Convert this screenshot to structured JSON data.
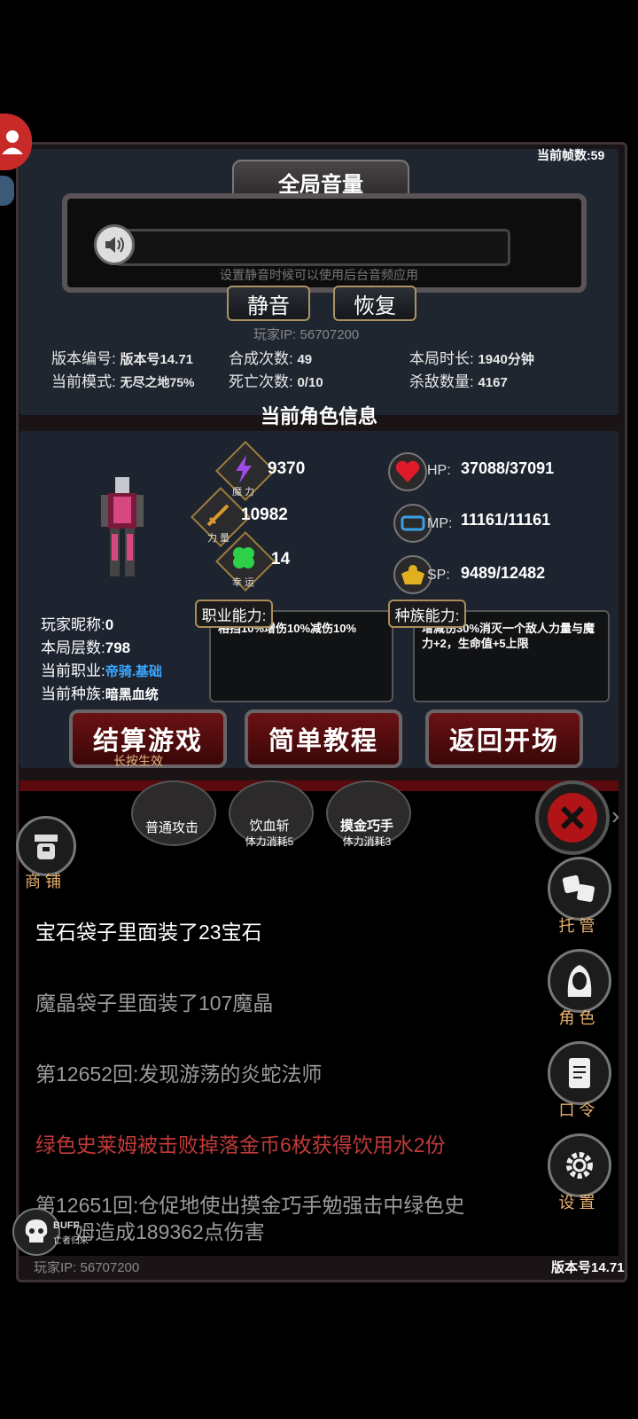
{
  "header": {
    "frame_counter": "当前帧数:59"
  },
  "volume": {
    "title": "全局音量",
    "hint": "设置静音时候可以使用后台音频应用",
    "mute_label": "静音",
    "restore_label": "恢复"
  },
  "player_ip_top": "玩家IP:  56707200",
  "stats": {
    "version_label": "版本编号:",
    "version_value": "版本号14.71",
    "mode_label": "当前模式:",
    "mode_value": "无尽之地75%",
    "craft_label": "合成次数:",
    "craft_value": "49",
    "death_label": "死亡次数:",
    "death_value": "0/10",
    "duration_label": "本局时长:",
    "duration_value": "1940分钟",
    "kills_label": "杀敌数量:",
    "kills_value": "4167"
  },
  "character": {
    "section_title": "当前角色信息",
    "magic_value": "9370",
    "magic_label": "魔 力",
    "strength_value": "10982",
    "strength_label": "力 量",
    "luck_value": "14",
    "luck_label": "幸 运",
    "hp_label": "HP:",
    "hp_value": "37088/37091",
    "mp_label": "MP:",
    "mp_value": "11161/11161",
    "sp_label": "SP:",
    "sp_value": "9489/12482",
    "nickname_label": "玩家昵称:",
    "nickname_value": "0",
    "floor_label": "本局层数:",
    "floor_value": "798",
    "job_label": "当前职业:",
    "job_value": "帝骑.基础",
    "race_label": "当前种族:",
    "race_value": "暗黑血统",
    "job_ability_tag": "职业能力:",
    "job_ability_text": "格挡10%增伤10%减伤10%",
    "race_ability_tag": "种族能力:",
    "race_ability_text": "增减伤30%消灭一个敌人力量与魔力+2，生命值+5上限"
  },
  "actions": {
    "settle_label": "结算游戏",
    "settle_hint": "长按生效",
    "tutorial_label": "简单教程",
    "return_label": "返回开场"
  },
  "skills": [
    {
      "name": "普通攻击",
      "cost": ""
    },
    {
      "name": "饮血斩",
      "cost": "体力消耗5"
    },
    {
      "name": "摸金巧手",
      "cost": "体力消耗3"
    }
  ],
  "shop_label": "商 铺",
  "log": [
    {
      "text": "宝石袋子里面装了23宝石",
      "color": "#ffffff"
    },
    {
      "text": "魔晶袋子里面装了107魔晶",
      "color": "#9a9a9a"
    },
    {
      "text": "第12652回:发现游荡的炎蛇法师",
      "color": "#9a9a9a"
    },
    {
      "text": "绿色史莱姆被击败掉落金币6枚获得饮用水2份",
      "color": "#c23a3a"
    },
    {
      "text": "第12651回:仓促地使出摸金巧手勉强击中绿色史",
      "color": "#9a9a9a"
    },
    {
      "text": "姆造成189362点伤害",
      "color": "#9a9a9a"
    }
  ],
  "side_menu": {
    "auto_label": "托 管",
    "role_label": "角 色",
    "command_label": "口 令",
    "settings_label": "设 置"
  },
  "buff": {
    "tag": "BUFF",
    "name": "亡者归来"
  },
  "footer": {
    "player_ip": "玩家IP:  56707200",
    "version": "版本号14.71"
  }
}
